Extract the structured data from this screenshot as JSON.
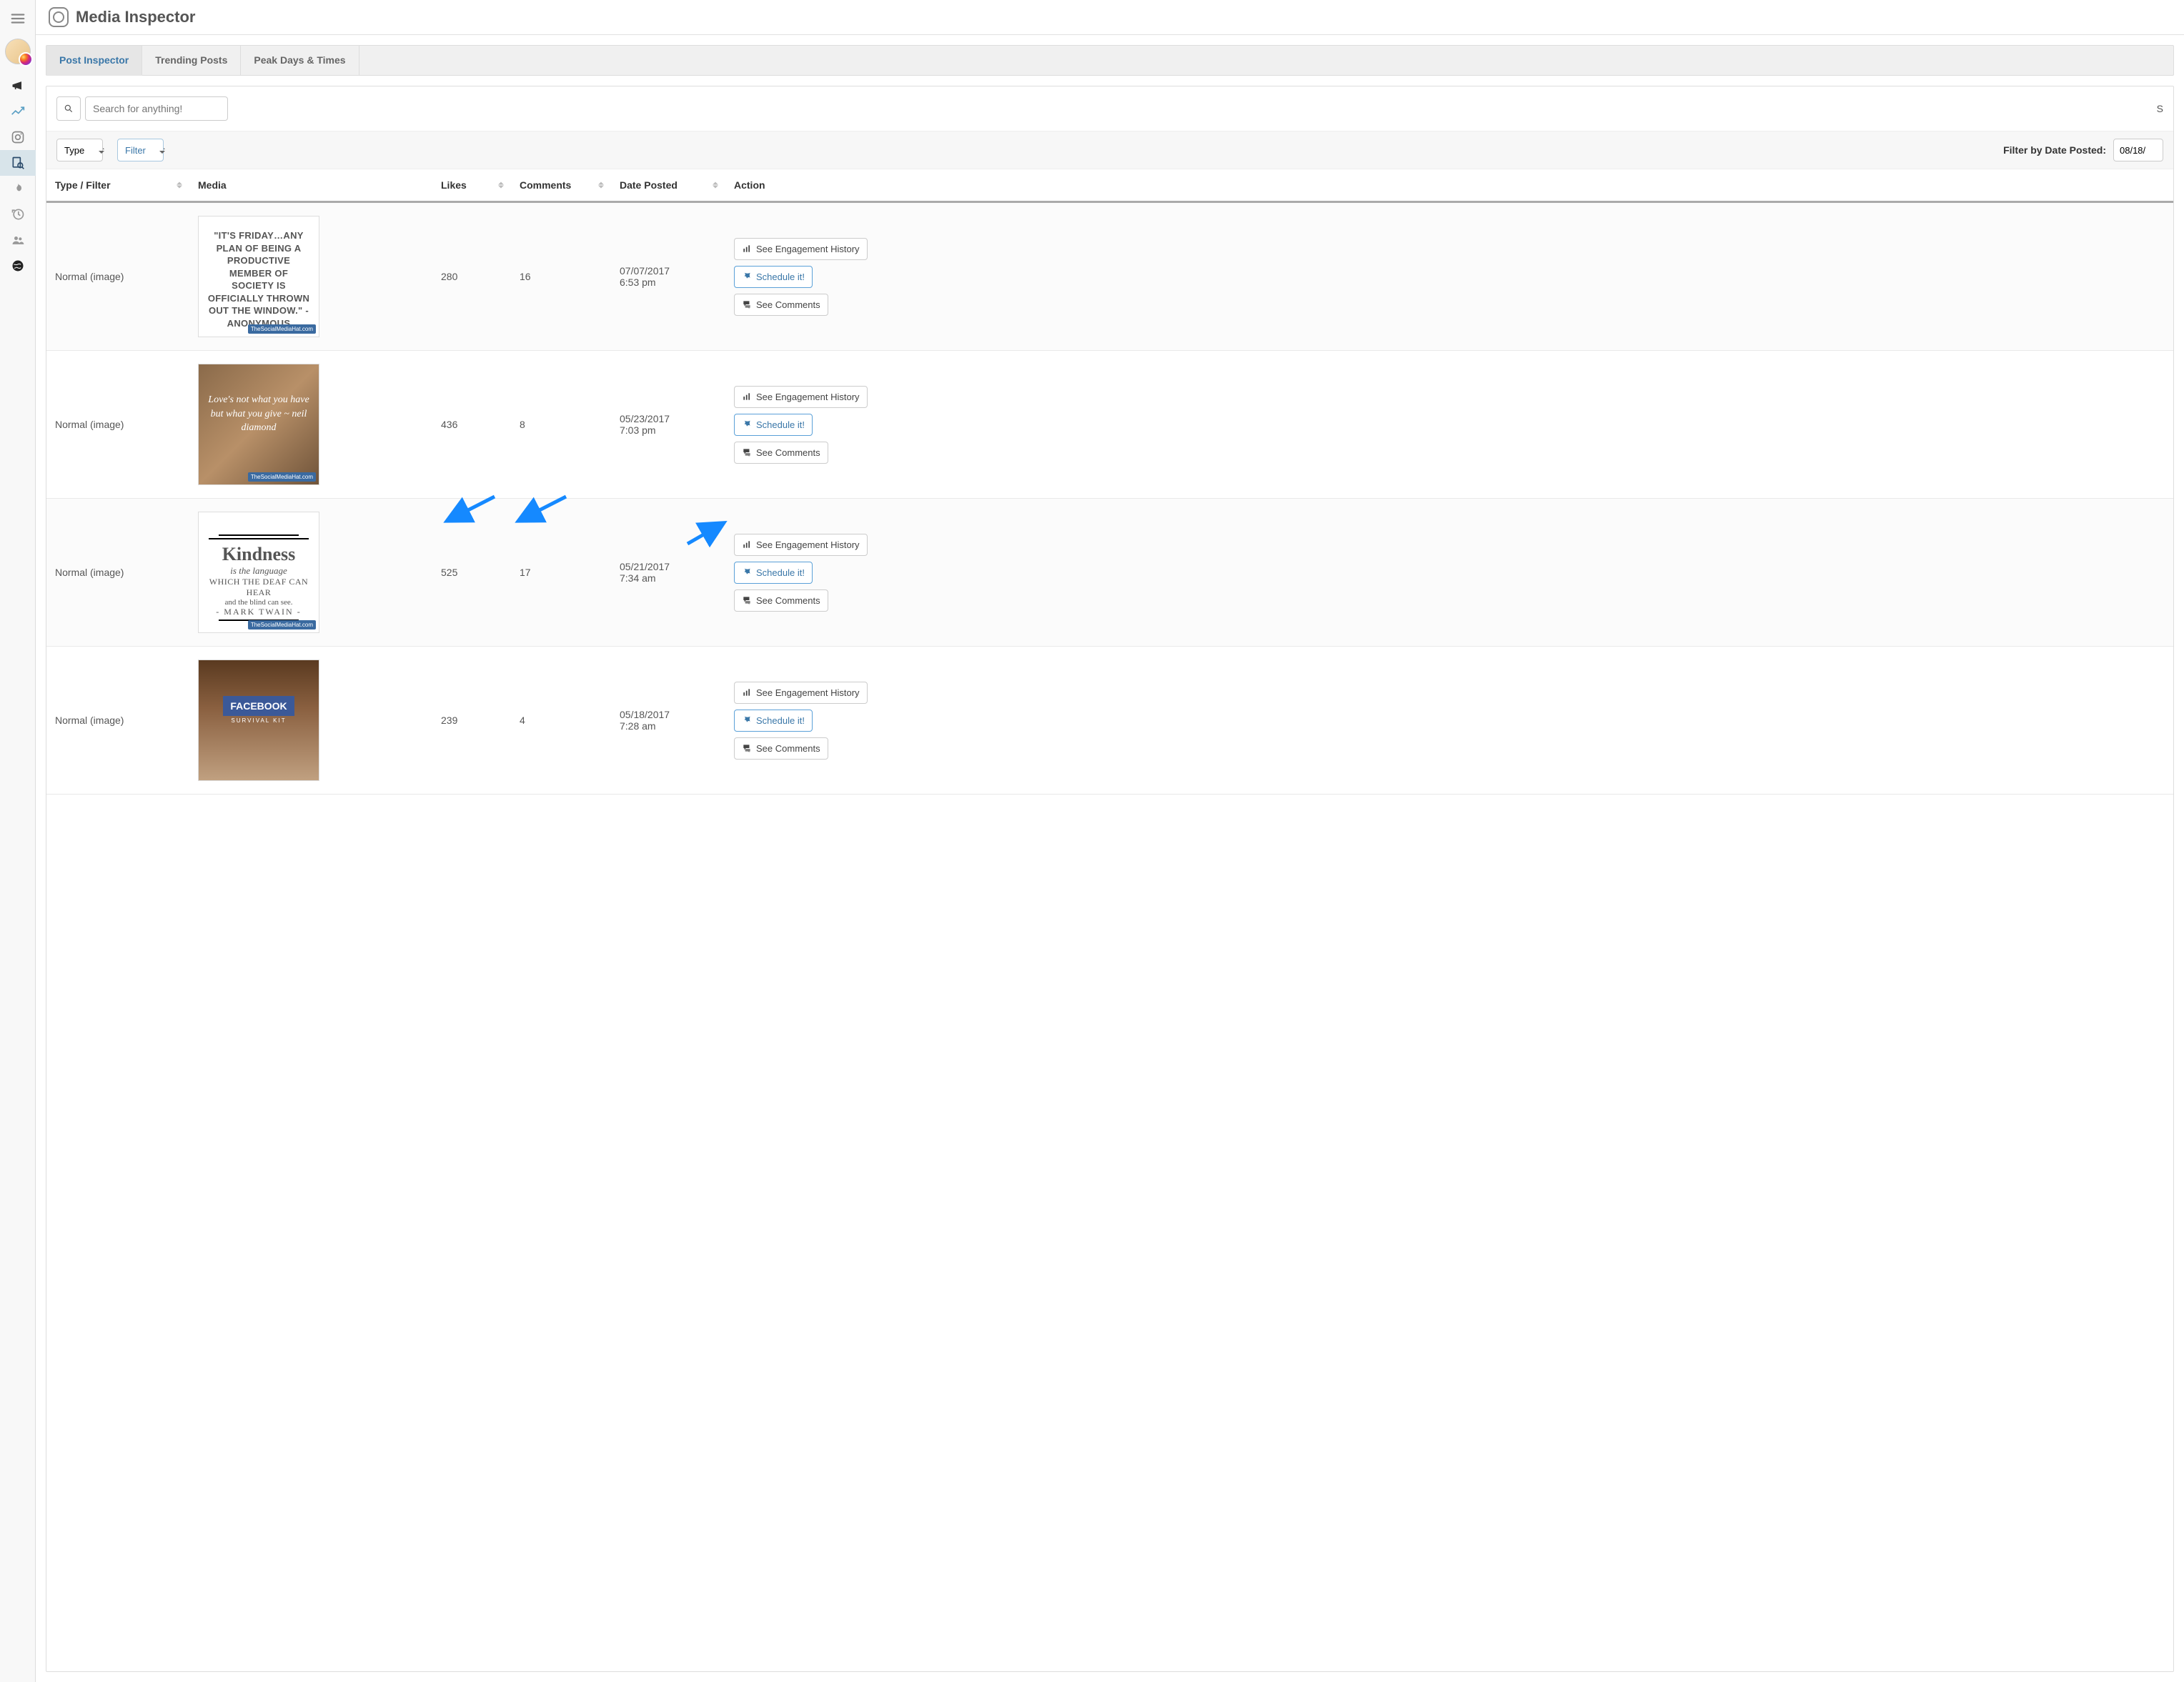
{
  "header": {
    "title": "Media Inspector"
  },
  "tabs": [
    {
      "label": "Post Inspector",
      "active": true
    },
    {
      "label": "Trending Posts",
      "active": false
    },
    {
      "label": "Peak Days & Times",
      "active": false
    }
  ],
  "toolbar": {
    "search_placeholder": "Search for anything!",
    "right_truncated": "S"
  },
  "filter_row": {
    "type_label": "Type",
    "filter_label": "Filter",
    "date_filter_label": "Filter by Date Posted:",
    "date_value": "08/18/"
  },
  "columns": {
    "type": "Type / Filter",
    "media": "Media",
    "likes": "Likes",
    "comments": "Comments",
    "date": "Date Posted",
    "action": "Action"
  },
  "action_labels": {
    "engagement": "See Engagement History",
    "schedule": "Schedule it!",
    "comments": "See Comments"
  },
  "rows": [
    {
      "type": "Normal (image)",
      "media_kind": "quote_white",
      "media_text": "\"IT'S FRIDAY…ANY PLAN OF BEING A PRODUCTIVE MEMBER OF SOCIETY IS OFFICIALLY THROWN OUT THE WINDOW.\" - ANONYMOUS",
      "watermark": "TheSocialMediaHat.com",
      "likes": "280",
      "comments": "16",
      "date": "07/07/2017",
      "time": "6:53 pm",
      "highlight": false
    },
    {
      "type": "Normal (image)",
      "media_kind": "paper_scribble",
      "media_text": "Love's not what you have but what you give ~ neil diamond",
      "watermark": "TheSocialMediaHat.com",
      "likes": "436",
      "comments": "8",
      "date": "05/23/2017",
      "time": "7:03 pm",
      "highlight": false
    },
    {
      "type": "Normal (image)",
      "media_kind": "kindness",
      "media_big": "Kindness",
      "media_sub1": "is the language",
      "media_sub2": "WHICH THE DEAF CAN HEAR",
      "media_sub3": "and the blind can see.",
      "media_sub4": "- MARK TWAIN -",
      "watermark": "TheSocialMediaHat.com",
      "likes": "525",
      "comments": "17",
      "date": "05/21/2017",
      "time": "7:34 am",
      "highlight": true
    },
    {
      "type": "Normal (image)",
      "media_kind": "desk_fb",
      "media_text": "THE FACEBOOK SURVIVAL KIT",
      "watermark": "",
      "likes": "239",
      "comments": "4",
      "date": "05/18/2017",
      "time": "7:28 am",
      "highlight": false
    }
  ],
  "sidebar_icons": [
    "hamburger-icon",
    "avatar",
    "megaphone-icon",
    "trend-icon",
    "instagram-icon",
    "inspect-icon",
    "flame-icon",
    "history-icon",
    "users-icon",
    "globe-icon"
  ]
}
